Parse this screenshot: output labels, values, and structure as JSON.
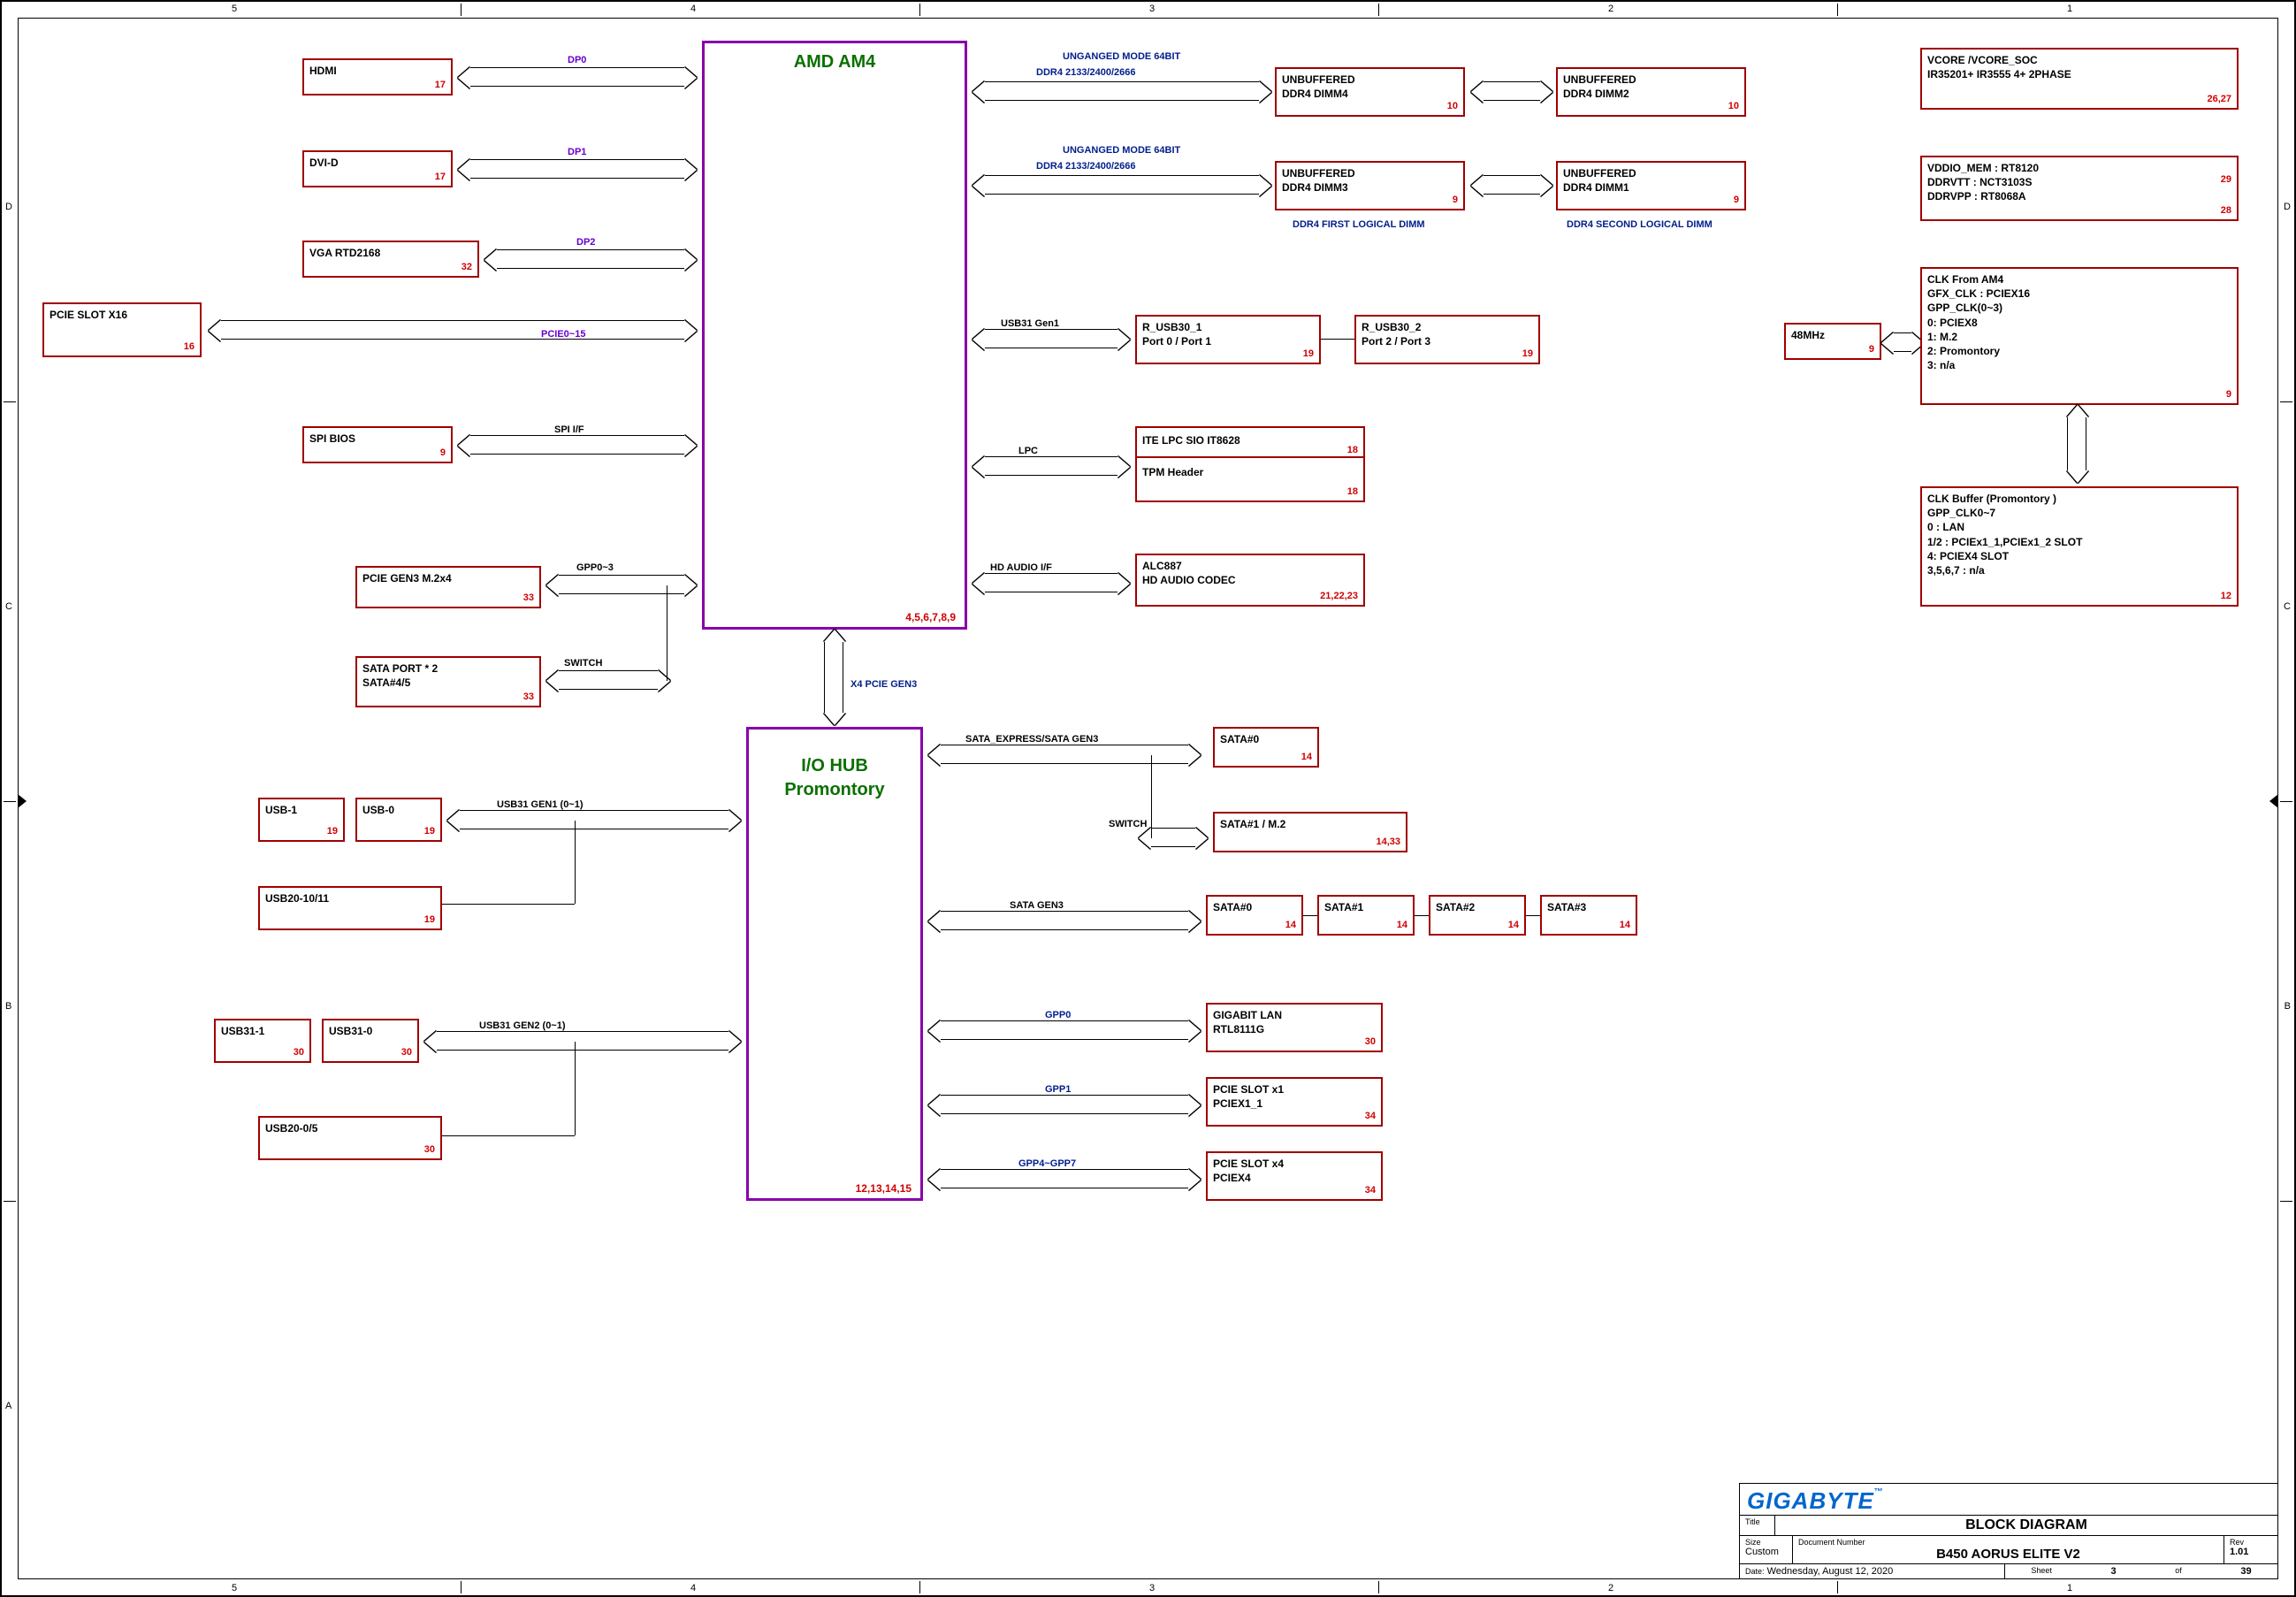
{
  "zones_top": [
    "5",
    "4",
    "3",
    "2",
    "1"
  ],
  "zones_side": [
    "D",
    "C",
    "B",
    "A"
  ],
  "cpu": {
    "title": "AMD AM4",
    "pages": "4,5,6,7,8,9"
  },
  "pch": {
    "title1": "I/O HUB",
    "title2": "Promontory",
    "pages": "12,13,14,15"
  },
  "left_io": {
    "hdmi": {
      "label": "HDMI",
      "pg": "17",
      "bus": "DP0"
    },
    "dvid": {
      "label": "DVI-D",
      "pg": "17",
      "bus": "DP1"
    },
    "vga": {
      "label": "VGA RTD2168",
      "pg": "32",
      "bus": "DP2"
    },
    "pcie16": {
      "label": "PCIE SLOT X16",
      "pg": "16",
      "bus": "PCIE0~15"
    },
    "spi": {
      "label": "SPI BIOS",
      "pg": "9",
      "bus": "SPI I/F"
    },
    "m2": {
      "label": "PCIE GEN3  M.2x4",
      "pg": "33",
      "bus": "GPP0~3"
    },
    "sata45": {
      "label1": "SATA PORT * 2",
      "label2": "SATA#4/5",
      "pg": "33",
      "bus": "SWITCH"
    }
  },
  "dram": {
    "mode": "UNGANGED MODE 64BIT",
    "speed": "DDR4 2133/2400/2666",
    "dimm4": {
      "l1": "UNBUFFERED",
      "l2": "DDR4 DIMM4",
      "pg": "10"
    },
    "dimm2": {
      "l1": "UNBUFFERED",
      "l2": "DDR4 DIMM2",
      "pg": "10"
    },
    "dimm3": {
      "l1": "UNBUFFERED",
      "l2": "DDR4 DIMM3",
      "pg": "9"
    },
    "dimm1": {
      "l1": "UNBUFFERED",
      "l2": "DDR4 DIMM1",
      "pg": "9"
    },
    "first": "DDR4 FIRST LOGICAL DIMM",
    "second": "DDR4 SECOND LOGICAL DIMM"
  },
  "cpu_right": {
    "usb31": {
      "bus": "USB31 Gen1",
      "b1": {
        "l1": "R_USB30_1",
        "l2": "Port 0 / Port 1",
        "pg": "19"
      },
      "b2": {
        "l1": "R_USB30_2",
        "l2": "Port 2 / Port 3",
        "pg": "19"
      }
    },
    "lpc": {
      "bus": "LPC",
      "b1": {
        "l1": "ITE LPC SIO IT8628",
        "pg": "18"
      },
      "b2": {
        "l1": "TPM Header",
        "pg": "18"
      }
    },
    "hda": {
      "bus": "HD AUDIO I/F",
      "b1": {
        "l1": "ALC887",
        "l2": "HD AUDIO CODEC",
        "pg": "21,22,23"
      }
    }
  },
  "pch_left": {
    "usb1": {
      "label": "USB-1",
      "pg": "19"
    },
    "usb0": {
      "label": "USB-0",
      "pg": "19"
    },
    "usb31g1": "USB31 GEN1 (0~1)",
    "usb2_1011": {
      "label": "USB20-10/11",
      "pg": "19"
    },
    "usb311": {
      "label": "USB31-1",
      "pg": "30"
    },
    "usb310": {
      "label": "USB31-0",
      "pg": "30"
    },
    "usb31g2": "USB31 GEN2 (0~1)",
    "usb2_05": {
      "label": "USB20-0/5",
      "pg": "30"
    }
  },
  "pch_right": {
    "express": {
      "bus": "SATA_EXPRESS/SATA GEN3",
      "sata0": {
        "l": "SATA#0",
        "pg": "14"
      },
      "sata1": {
        "l": "SATA#1  /  M.2",
        "pg": "14,33"
      },
      "sw": "SWITCH"
    },
    "satagen3": {
      "bus": "SATA GEN3",
      "s0": {
        "l": "SATA#0",
        "pg": "14"
      },
      "s1": {
        "l": "SATA#1",
        "pg": "14"
      },
      "s2": {
        "l": "SATA#2",
        "pg": "14"
      },
      "s3": {
        "l": "SATA#3",
        "pg": "14"
      }
    },
    "gpp0": {
      "bus": "GPP0",
      "l1": "GIGABIT LAN",
      "l2": "RTL8111G",
      "pg": "30"
    },
    "gpp1": {
      "bus": "GPP1",
      "l1": "PCIE SLOT x1",
      "l2": "PCIEX1_1",
      "pg": "34"
    },
    "gpp47": {
      "bus": "GPP4~GPP7",
      "l1": "PCIE SLOT x4",
      "l2": "PCIEX4",
      "pg": "34"
    }
  },
  "cpu_pch_link": "X4 PCIE GEN3",
  "power": {
    "vcore": {
      "l1": "VCORE /VCORE_SOC",
      "l2": "IR35201+ IR3555  4+ 2PHASE",
      "pg": "26,27"
    },
    "vddio": {
      "l1": "VDDIO_MEM : RT8120",
      "l2": "DDRVTT : NCT3103S",
      "l3": "DDRVPP : RT8068A",
      "pg1": "29",
      "pg2": "28"
    },
    "clk48": {
      "label": "48MHz",
      "pg": "9"
    },
    "clk_am4": {
      "l1": "CLK From AM4",
      "l2": "GFX_CLK :  PCIEX16",
      "l3": "GPP_CLK(0~3)",
      "l4": "0:  PCIEX8",
      "l5": "1:  M.2",
      "l6": "2:  Promontory",
      "l7": "3:  n/a",
      "pg": "9"
    },
    "clk_buf": {
      "l1": "CLK Buffer (Promontory )",
      "l2": "GPP_CLK0~7",
      "l3": "0 : LAN",
      "l4": "1/2 : PCIEx1_1,PCIEx1_2  SLOT",
      "l5": "4:  PCIEX4 SLOT",
      "l6": "3,5,6,7 : n/a",
      "pg": "12"
    }
  },
  "titleblock": {
    "brand": "GIGABYTE",
    "tm": "™",
    "title_lbl": "Title",
    "title": "BLOCK DIAGRAM",
    "size_lbl": "Size",
    "size": "Custom",
    "docnum_lbl": "Document Number",
    "docnum": "B450 AORUS ELITE V2",
    "rev_lbl": "Rev",
    "rev": "1.01",
    "date_lbl": "Date:",
    "date": "Wednesday, August 12, 2020",
    "sheet_lbl": "Sheet",
    "sheet": "3",
    "of_lbl": "of",
    "total": "39"
  }
}
